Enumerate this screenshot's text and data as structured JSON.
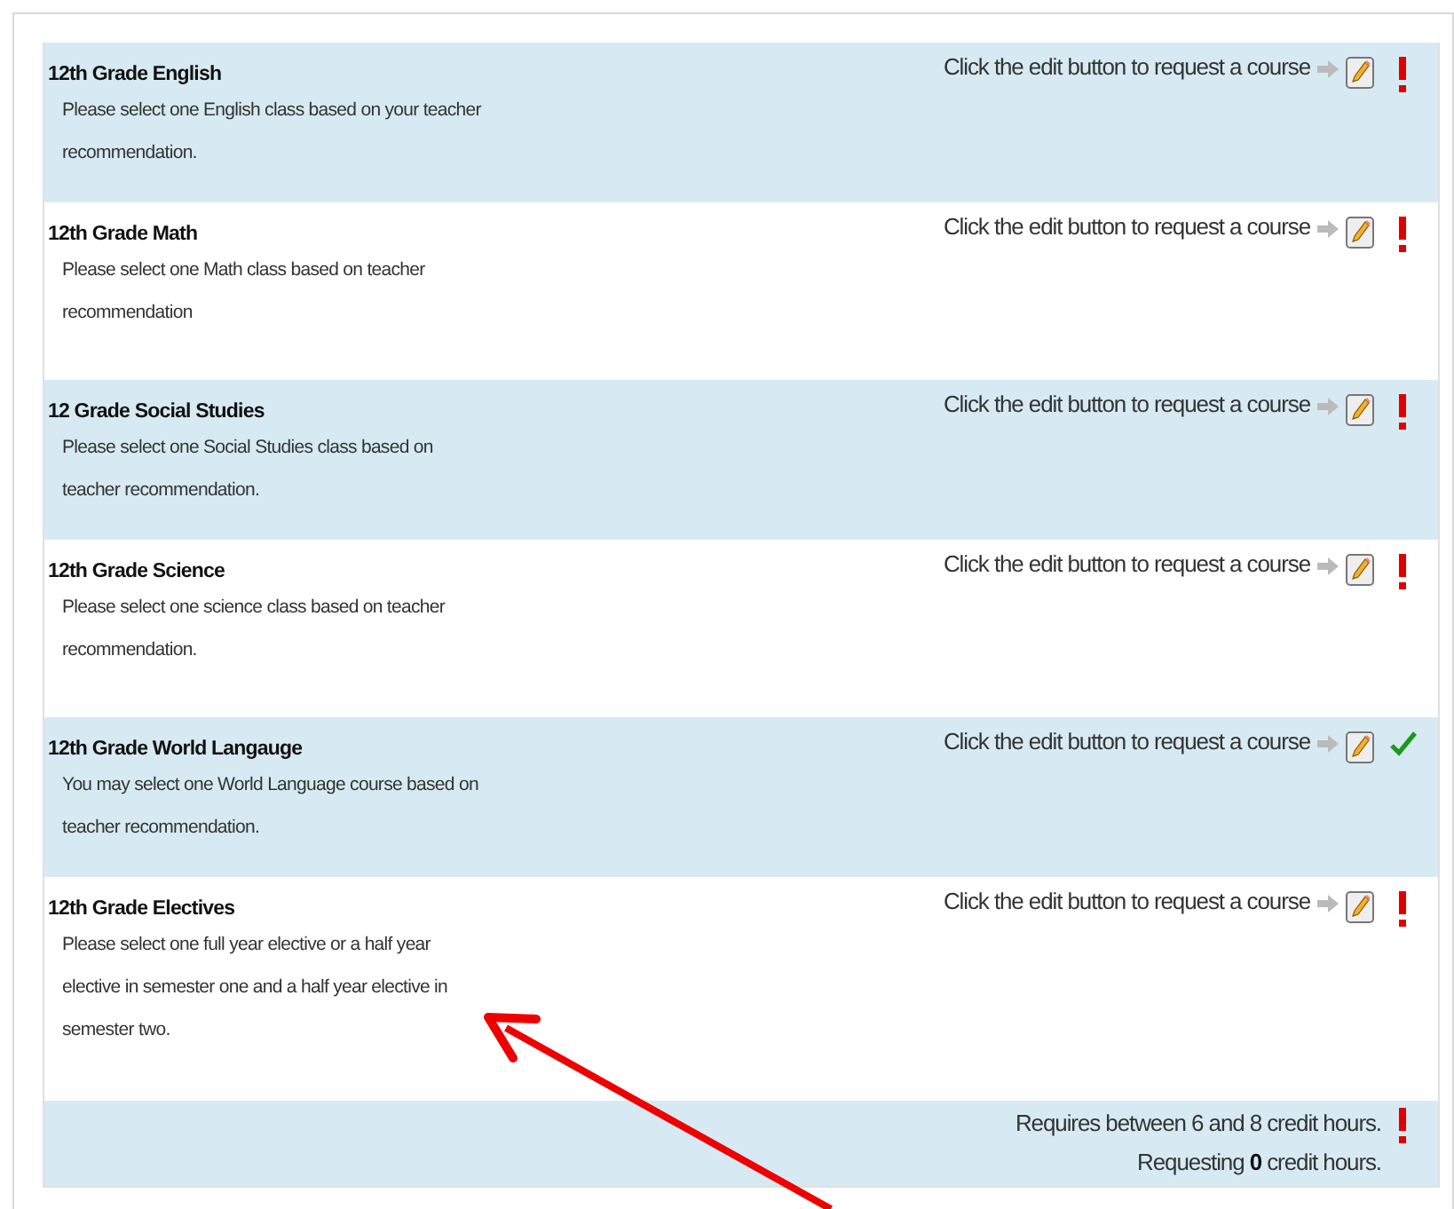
{
  "requirements": [
    {
      "title": "12th Grade English",
      "description": "Please select one English class based on your teacher recommendation.",
      "prompt": "Click the edit button to request a course",
      "complete": false
    },
    {
      "title": "12th Grade Math",
      "description": "Please select one Math class based on teacher recommendation",
      "prompt": "Click the edit button to request a course",
      "complete": false
    },
    {
      "title": "12 Grade Social Studies",
      "description": "Please select one Social Studies class based on teacher recommendation.",
      "prompt": "Click the edit button to request a course",
      "complete": false
    },
    {
      "title": "12th Grade Science",
      "description": "Please select one science class based on teacher recommendation.",
      "prompt": "Click the edit button to request a course",
      "complete": false
    },
    {
      "title": "12th Grade World Langauge",
      "description": "You may select one World Language course based on teacher recommendation.",
      "prompt": "Click the edit button to request a course",
      "complete": true
    },
    {
      "title": "12th Grade Electives",
      "description": "Please select one full year elective or a half year elective in semester one and a half year elective in semester two.",
      "prompt": "Click the edit button to request a course",
      "complete": false
    }
  ],
  "summary": {
    "requirement": "Requires between 6 and 8 credit hours.",
    "requesting": "Requesting **0** credit hours.",
    "complete": false
  }
}
